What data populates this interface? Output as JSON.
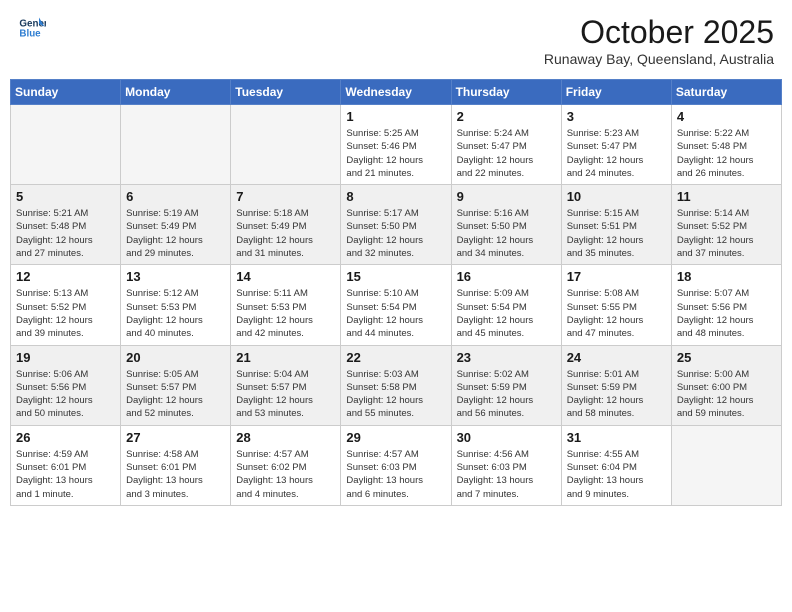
{
  "header": {
    "logo_line1": "General",
    "logo_line2": "Blue",
    "month": "October 2025",
    "location": "Runaway Bay, Queensland, Australia"
  },
  "weekdays": [
    "Sunday",
    "Monday",
    "Tuesday",
    "Wednesday",
    "Thursday",
    "Friday",
    "Saturday"
  ],
  "weeks": [
    [
      {
        "day": "",
        "info": ""
      },
      {
        "day": "",
        "info": ""
      },
      {
        "day": "",
        "info": ""
      },
      {
        "day": "1",
        "info": "Sunrise: 5:25 AM\nSunset: 5:46 PM\nDaylight: 12 hours\nand 21 minutes."
      },
      {
        "day": "2",
        "info": "Sunrise: 5:24 AM\nSunset: 5:47 PM\nDaylight: 12 hours\nand 22 minutes."
      },
      {
        "day": "3",
        "info": "Sunrise: 5:23 AM\nSunset: 5:47 PM\nDaylight: 12 hours\nand 24 minutes."
      },
      {
        "day": "4",
        "info": "Sunrise: 5:22 AM\nSunset: 5:48 PM\nDaylight: 12 hours\nand 26 minutes."
      }
    ],
    [
      {
        "day": "5",
        "info": "Sunrise: 5:21 AM\nSunset: 5:48 PM\nDaylight: 12 hours\nand 27 minutes."
      },
      {
        "day": "6",
        "info": "Sunrise: 5:19 AM\nSunset: 5:49 PM\nDaylight: 12 hours\nand 29 minutes."
      },
      {
        "day": "7",
        "info": "Sunrise: 5:18 AM\nSunset: 5:49 PM\nDaylight: 12 hours\nand 31 minutes."
      },
      {
        "day": "8",
        "info": "Sunrise: 5:17 AM\nSunset: 5:50 PM\nDaylight: 12 hours\nand 32 minutes."
      },
      {
        "day": "9",
        "info": "Sunrise: 5:16 AM\nSunset: 5:50 PM\nDaylight: 12 hours\nand 34 minutes."
      },
      {
        "day": "10",
        "info": "Sunrise: 5:15 AM\nSunset: 5:51 PM\nDaylight: 12 hours\nand 35 minutes."
      },
      {
        "day": "11",
        "info": "Sunrise: 5:14 AM\nSunset: 5:52 PM\nDaylight: 12 hours\nand 37 minutes."
      }
    ],
    [
      {
        "day": "12",
        "info": "Sunrise: 5:13 AM\nSunset: 5:52 PM\nDaylight: 12 hours\nand 39 minutes."
      },
      {
        "day": "13",
        "info": "Sunrise: 5:12 AM\nSunset: 5:53 PM\nDaylight: 12 hours\nand 40 minutes."
      },
      {
        "day": "14",
        "info": "Sunrise: 5:11 AM\nSunset: 5:53 PM\nDaylight: 12 hours\nand 42 minutes."
      },
      {
        "day": "15",
        "info": "Sunrise: 5:10 AM\nSunset: 5:54 PM\nDaylight: 12 hours\nand 44 minutes."
      },
      {
        "day": "16",
        "info": "Sunrise: 5:09 AM\nSunset: 5:54 PM\nDaylight: 12 hours\nand 45 minutes."
      },
      {
        "day": "17",
        "info": "Sunrise: 5:08 AM\nSunset: 5:55 PM\nDaylight: 12 hours\nand 47 minutes."
      },
      {
        "day": "18",
        "info": "Sunrise: 5:07 AM\nSunset: 5:56 PM\nDaylight: 12 hours\nand 48 minutes."
      }
    ],
    [
      {
        "day": "19",
        "info": "Sunrise: 5:06 AM\nSunset: 5:56 PM\nDaylight: 12 hours\nand 50 minutes."
      },
      {
        "day": "20",
        "info": "Sunrise: 5:05 AM\nSunset: 5:57 PM\nDaylight: 12 hours\nand 52 minutes."
      },
      {
        "day": "21",
        "info": "Sunrise: 5:04 AM\nSunset: 5:57 PM\nDaylight: 12 hours\nand 53 minutes."
      },
      {
        "day": "22",
        "info": "Sunrise: 5:03 AM\nSunset: 5:58 PM\nDaylight: 12 hours\nand 55 minutes."
      },
      {
        "day": "23",
        "info": "Sunrise: 5:02 AM\nSunset: 5:59 PM\nDaylight: 12 hours\nand 56 minutes."
      },
      {
        "day": "24",
        "info": "Sunrise: 5:01 AM\nSunset: 5:59 PM\nDaylight: 12 hours\nand 58 minutes."
      },
      {
        "day": "25",
        "info": "Sunrise: 5:00 AM\nSunset: 6:00 PM\nDaylight: 12 hours\nand 59 minutes."
      }
    ],
    [
      {
        "day": "26",
        "info": "Sunrise: 4:59 AM\nSunset: 6:01 PM\nDaylight: 13 hours\nand 1 minute."
      },
      {
        "day": "27",
        "info": "Sunrise: 4:58 AM\nSunset: 6:01 PM\nDaylight: 13 hours\nand 3 minutes."
      },
      {
        "day": "28",
        "info": "Sunrise: 4:57 AM\nSunset: 6:02 PM\nDaylight: 13 hours\nand 4 minutes."
      },
      {
        "day": "29",
        "info": "Sunrise: 4:57 AM\nSunset: 6:03 PM\nDaylight: 13 hours\nand 6 minutes."
      },
      {
        "day": "30",
        "info": "Sunrise: 4:56 AM\nSunset: 6:03 PM\nDaylight: 13 hours\nand 7 minutes."
      },
      {
        "day": "31",
        "info": "Sunrise: 4:55 AM\nSunset: 6:04 PM\nDaylight: 13 hours\nand 9 minutes."
      },
      {
        "day": "",
        "info": ""
      }
    ]
  ]
}
